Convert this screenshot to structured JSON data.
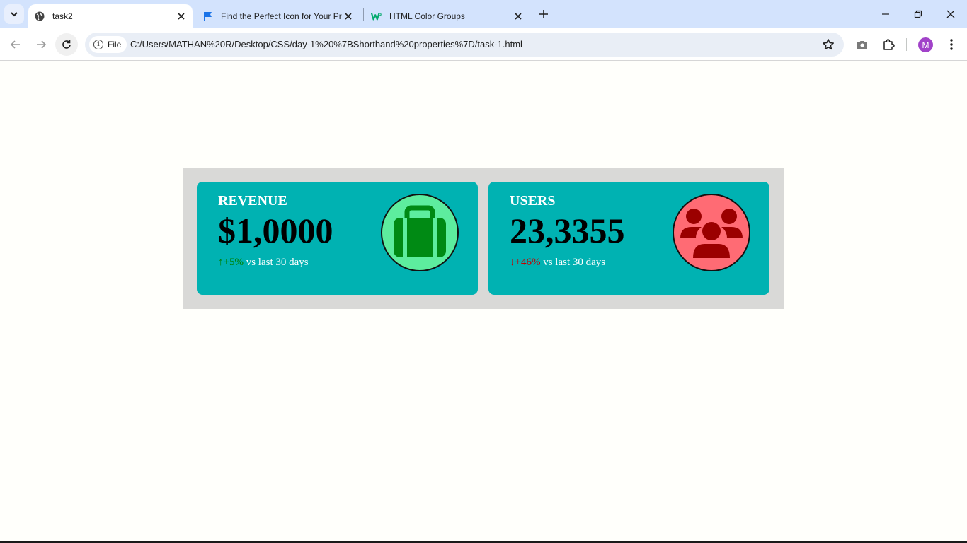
{
  "browser": {
    "tabs": [
      {
        "title": "task2",
        "active": true
      },
      {
        "title": "Find the Perfect Icon for Your Pr",
        "active": false
      },
      {
        "title": "HTML Color Groups",
        "active": false
      }
    ],
    "address": {
      "scheme_chip": "File",
      "url": "C:/Users/MATHAN%20R/Desktop/CSS/day-1%20%7BShorthand%20properties%7D/task-1.html"
    },
    "profile_initial": "M",
    "icons": {
      "tab_search": "chevron-down-icon",
      "back": "arrow-left-icon",
      "forward": "arrow-right-icon",
      "reload": "reload-icon",
      "bookmark": "star-icon",
      "screenshot": "camera-icon",
      "extensions": "puzzle-icon",
      "menu": "kebab-menu-icon"
    }
  },
  "cards": [
    {
      "label": "REVENUE",
      "value": "$1,0000",
      "trend_arrow": "↑",
      "trend_value": "+5%",
      "trend_text": " vs last 30 days",
      "trend_color": "#008000",
      "icon": "briefcase-icon",
      "icon_bg": "#5ded9e",
      "icon_color": "#008a14"
    },
    {
      "label": "USERS",
      "value": "23,3355",
      "trend_arrow": "↓",
      "trend_value": "+46%",
      "trend_text": " vs last 30 days",
      "trend_color": "#c40000",
      "icon": "users-group-icon",
      "icon_bg": "#ff6b74",
      "icon_color": "#9b0000"
    }
  ],
  "colors": {
    "card_bg": "#00b2b2",
    "panel_bg": "#d9d9d7",
    "tabstrip_bg": "#d3e3fd"
  }
}
